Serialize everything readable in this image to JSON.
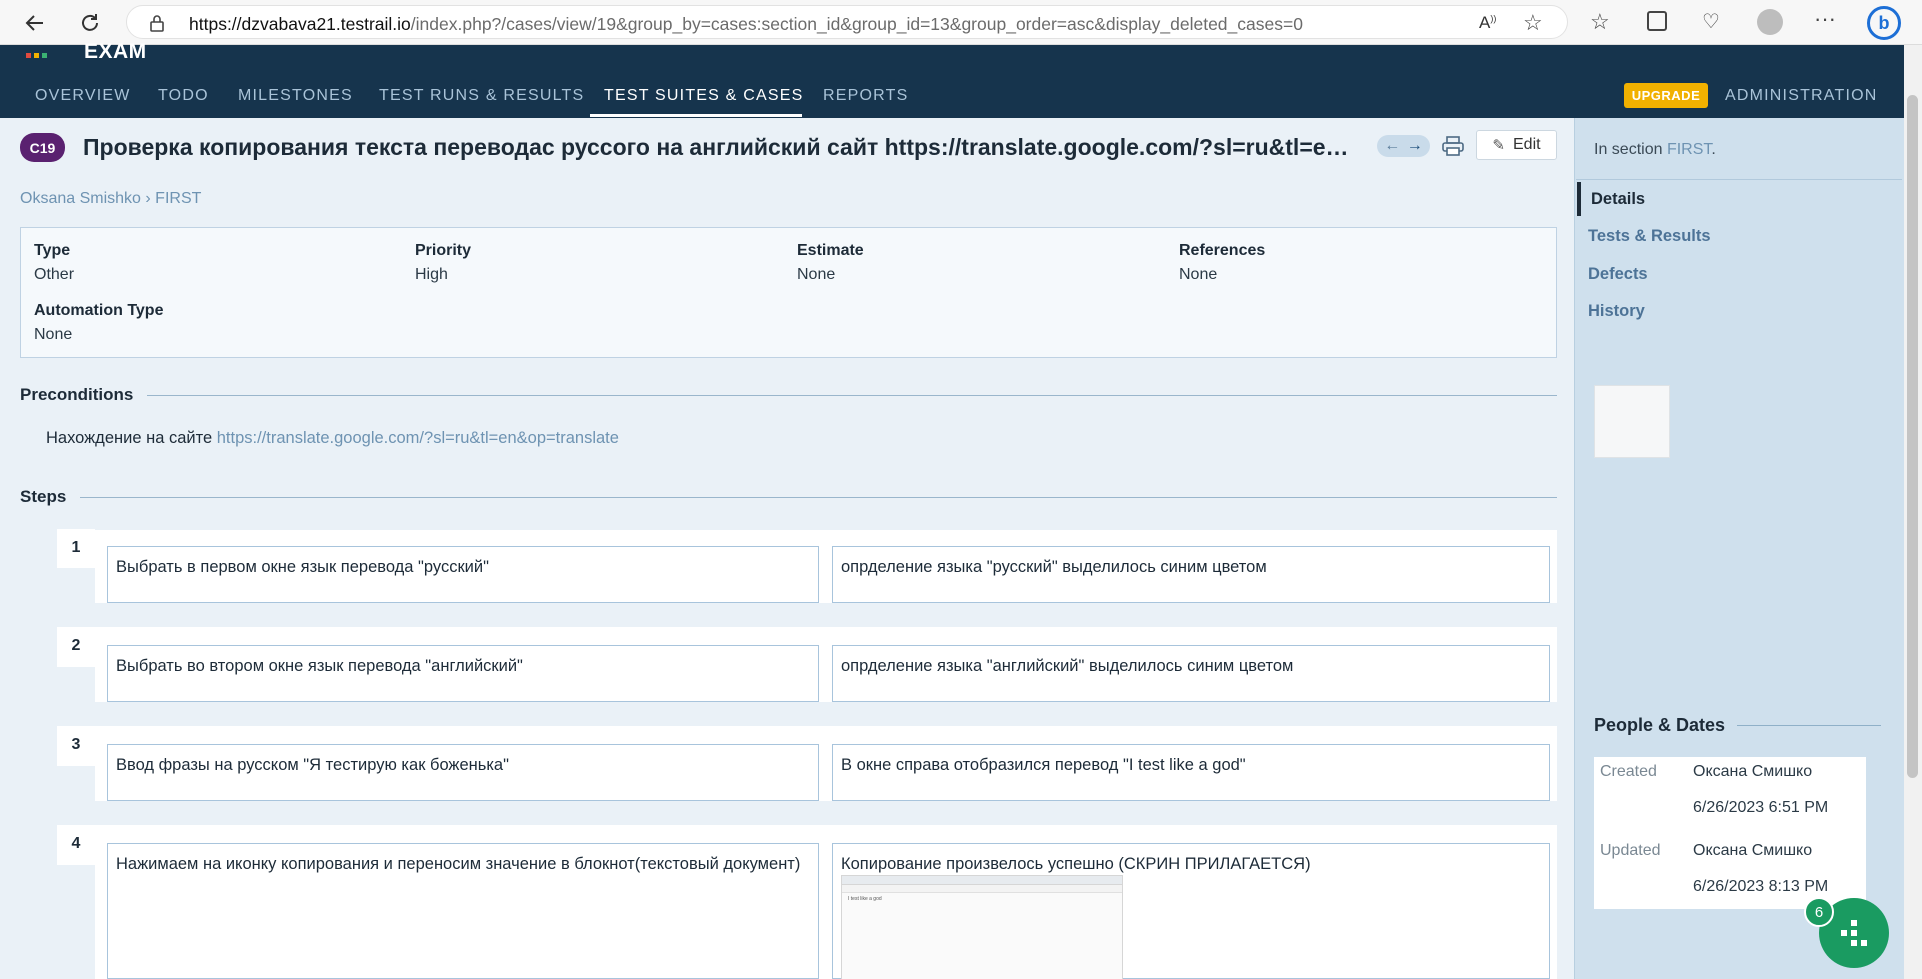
{
  "browser": {
    "url_host": "https://dzvabava21.testrail.io",
    "url_path": "/index.php?/cases/view/19&group_by=cases:section_id&group_id=13&group_order=asc&display_deleted_cases=0"
  },
  "header": {
    "project": "EXAM",
    "tabs": [
      "OVERVIEW",
      "TODO",
      "MILESTONES",
      "TEST RUNS & RESULTS",
      "TEST SUITES & CASES",
      "REPORTS"
    ],
    "upgrade": "UPGRADE",
    "admin": "ADMINISTRATION"
  },
  "case": {
    "id": "C19",
    "title": "Проверка копирования текста переводас руссого на английский сайт https://translate.google.com/?sl=ru&tl=en&op=translate",
    "edit": "Edit",
    "breadcrumb_user": "Oksana Smishko",
    "breadcrumb_sep": "›",
    "breadcrumb_section": "FIRST"
  },
  "fields": {
    "type_label": "Type",
    "type_value": "Other",
    "priority_label": "Priority",
    "priority_value": "High",
    "estimate_label": "Estimate",
    "estimate_value": "None",
    "references_label": "References",
    "references_value": "None",
    "automation_label": "Automation Type",
    "automation_value": "None"
  },
  "preconditions": {
    "heading": "Preconditions",
    "text": "Нахождение на сайте ",
    "link": "https://translate.google.com/?sl=ru&tl=en&op=translate"
  },
  "steps": {
    "heading": "Steps",
    "items": [
      {
        "num": "1",
        "action": "Выбрать в первом окне язык перевода \"русский\"",
        "expected": "опрделение языка \"русский\" выделилось синим цветом"
      },
      {
        "num": "2",
        "action": "Выбрать во втором окне язык перевода \"английский\"",
        "expected": "опрделение языка \"английский\" выделилось синим цветом"
      },
      {
        "num": "3",
        "action": "Ввод фразы на русском  \"Я тестирую как боженька\"",
        "expected": "В окне справа отобразился перевод \"I test like a god\""
      },
      {
        "num": "4",
        "action": "Нажимаем на иконку копирования и переносим значение в блокнот(текстовый документ)",
        "expected": "Копирование произвелось успешно (СКРИН ПРИЛАГАЕТСЯ)",
        "screenshot_text": "I test like a god"
      }
    ]
  },
  "sidebar": {
    "section_prefix": "In section ",
    "section_link": "FIRST",
    "section_suffix": ".",
    "items": [
      "Details",
      "Tests & Results",
      "Defects",
      "History"
    ],
    "people_title": "People & Dates",
    "created_label": "Created",
    "created_by": "Оксана Смишко",
    "created_at": "6/26/2023 6:51 PM",
    "updated_label": "Updated",
    "updated_by": "Оксана Смишко",
    "updated_at": "6/26/2023 8:13 PM"
  },
  "fab_badge": "6",
  "colors": {
    "header_bg": "#16344d",
    "badge": "#5a2170",
    "upgrade": "#f2b100",
    "fab": "#1a9b61",
    "link": "#6e93b2"
  }
}
